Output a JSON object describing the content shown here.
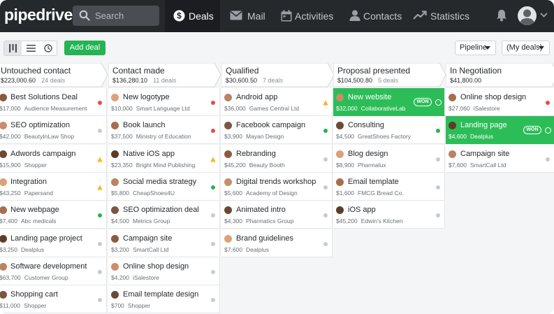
{
  "app": {
    "logo_text": "pipedrive"
  },
  "search": {
    "placeholder": "Search"
  },
  "nav": [
    {
      "label": "Deals",
      "icon": "dollar-icon",
      "active": true
    },
    {
      "label": "Mail",
      "icon": "mail-icon",
      "active": false
    },
    {
      "label": "Activities",
      "icon": "calendar-icon",
      "active": false
    },
    {
      "label": "Contacts",
      "icon": "person-icon",
      "active": false
    },
    {
      "label": "Statistics",
      "icon": "trend-icon",
      "active": false
    }
  ],
  "toolbar": {
    "add_deal": "Add deal",
    "pipeline": "Pipeline",
    "filter": "(My deals)",
    "views": [
      "pipeline-view-icon",
      "list-view-icon",
      "forecast-view-icon"
    ]
  },
  "colors": {
    "won_green": "#2dbd58",
    "add_green": "#25b454",
    "red": "#e64c4c",
    "yellow": "#f5b625",
    "grey": "#c7cbcf",
    "topbar": "#26292c"
  },
  "stages": [
    {
      "name": "Untouched contact",
      "value": "$223,000.60",
      "count": "24 deals",
      "deals": [
        {
          "title": "Best Solutions Deal",
          "amount": "$17,000",
          "org": "Audience Measurement",
          "status": "red"
        },
        {
          "title": "SEO optimization",
          "amount": "$42,000",
          "org": "BeautyInLaw Shop",
          "status": "grey"
        },
        {
          "title": "Adwords campaign",
          "amount": "$15,900",
          "org": "Shopper",
          "status": "yellow"
        },
        {
          "title": "Integration",
          "amount": "$43,250",
          "org": "Papersand",
          "status": "yellow"
        },
        {
          "title": "New webpage",
          "amount": "$7,400",
          "org": "Abc medicals",
          "status": "green"
        },
        {
          "title": "Landing page project",
          "amount": "$3,250",
          "org": "Dealplus",
          "status": "grey"
        },
        {
          "title": "Software development",
          "amount": "$63,700",
          "org": "Customer Group",
          "status": "grey"
        },
        {
          "title": "Shopping cart",
          "amount": "$11,000",
          "org": "Shopper",
          "status": "grey"
        }
      ]
    },
    {
      "name": "Contact made",
      "value": "$136,280.10",
      "count": "11 deals",
      "deals": [
        {
          "title": "New logotype",
          "amount": "$10,000",
          "org": "Smart Language Ltd",
          "status": "red"
        },
        {
          "title": "Book launch",
          "amount": "$37,500",
          "org": "Ministry of Education",
          "status": "red"
        },
        {
          "title": "Native iOS app",
          "amount": "$23,350",
          "org": "Bright Mind Publishing",
          "status": "yellow"
        },
        {
          "title": "Social media strategy",
          "amount": "$5,800",
          "org": "CheapShoes4U",
          "status": "green"
        },
        {
          "title": "SEO optimization deal",
          "amount": "$4,500",
          "org": "Metrics Group",
          "status": "grey"
        },
        {
          "title": "Campaign site",
          "amount": "$3,200",
          "org": "SmartCall Ltd",
          "status": "grey"
        },
        {
          "title": "Online shop design",
          "amount": "$4,200",
          "org": "iSalestore",
          "status": "grey"
        },
        {
          "title": "Email template design",
          "amount": "$700",
          "org": "Shopper",
          "status": "grey"
        }
      ]
    },
    {
      "name": "Qualified",
      "value": "$30,600.50",
      "count": "7 deals",
      "deals": [
        {
          "title": "Android app",
          "amount": "$36,000",
          "org": "Games Central Ltd",
          "status": "yellow"
        },
        {
          "title": "Facebook campaign",
          "amount": "$3,900",
          "org": "Mayan Design",
          "status": "green"
        },
        {
          "title": "Rebranding",
          "amount": "$45,200",
          "org": "Beauty Booth",
          "status": "grey"
        },
        {
          "title": "Digital trends workshop",
          "amount": "$5,600",
          "org": "Academy of Design",
          "status": "grey"
        },
        {
          "title": "Animated intro",
          "amount": "$4,300",
          "org": "Pharmatics Group",
          "status": "grey"
        },
        {
          "title": "Brand guidelines",
          "amount": "$7,600",
          "org": "Dealplus",
          "status": "grey"
        }
      ]
    },
    {
      "name": "Proposal presented",
      "value": "$104,500.80",
      "count": "5 deals",
      "deals": [
        {
          "title": "New website",
          "amount": "$32,000",
          "org": "CollaborativeLab",
          "status": "won",
          "badge": "WON"
        },
        {
          "title": "Consulting",
          "amount": "$4,500",
          "org": "GreatShoes Factory",
          "status": "green"
        },
        {
          "title": "Blog design",
          "amount": "$8,900",
          "org": "Pharmalux",
          "status": "grey"
        },
        {
          "title": "Email template",
          "amount": "$1,600",
          "org": "FMCG Bread Co.",
          "status": "grey"
        },
        {
          "title": "iOS app",
          "amount": "$45,200",
          "org": "Edwin's Kitchen",
          "status": "grey"
        }
      ]
    },
    {
      "name": "In Negotiation",
      "value": "$41,800.00",
      "count": "",
      "deals": [
        {
          "title": "Online shop design",
          "amount": "$27,060",
          "org": "iSalestore",
          "status": "red"
        },
        {
          "title": "Landing page",
          "amount": "$4,600",
          "org": "Dealplus",
          "status": "won",
          "badge": "WON"
        },
        {
          "title": "Campaign site",
          "amount": "$7,600",
          "org": "SmartCall Ltd",
          "status": "grey"
        }
      ]
    }
  ]
}
